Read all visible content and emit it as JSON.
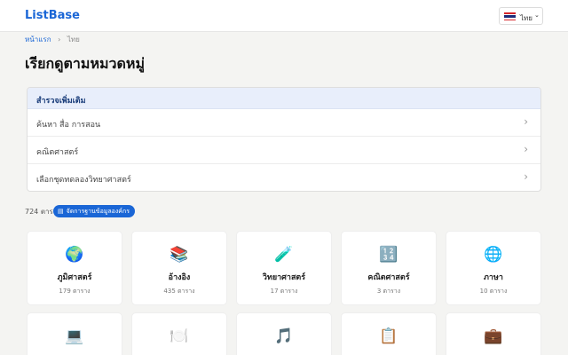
{
  "header": {
    "logo": "ListBase",
    "lang_label": "ไทย"
  },
  "breadcrumb": {
    "home": "หน้าแรก",
    "sep": "›",
    "current": "ไทย"
  },
  "page_title": "เรียกดูตามหมวดหมู่",
  "explore": {
    "heading": "สำรวจเพิ่มเติม",
    "items": [
      {
        "label": "ค้นหา สื่อ การสอน"
      },
      {
        "label": "คณิตศาสตร์"
      },
      {
        "label": "เลือกชุดทดลองวิทยาศาสตร์"
      }
    ]
  },
  "summary": {
    "count": "724 ตาราง",
    "badge": "จัดการฐานข้อมูลองค์กร"
  },
  "categories": [
    {
      "icon": "🌍",
      "name": "ภูมิศาสตร์",
      "count": "179 ตาราง"
    },
    {
      "icon": "📚",
      "name": "อ้างอิง",
      "count": "435 ตาราง"
    },
    {
      "icon": "🧪",
      "name": "วิทยาศาสตร์",
      "count": "17 ตาราง"
    },
    {
      "icon": "🔢",
      "name": "คณิตศาสตร์",
      "count": "3 ตาราง"
    },
    {
      "icon": "🌐",
      "name": "ภาษา",
      "count": "10 ตาราง"
    }
  ],
  "categories_row2": [
    {
      "icon": "💻"
    },
    {
      "icon": "🍽️"
    },
    {
      "icon": "🎵"
    },
    {
      "icon": "📋"
    },
    {
      "icon": "💼"
    }
  ]
}
